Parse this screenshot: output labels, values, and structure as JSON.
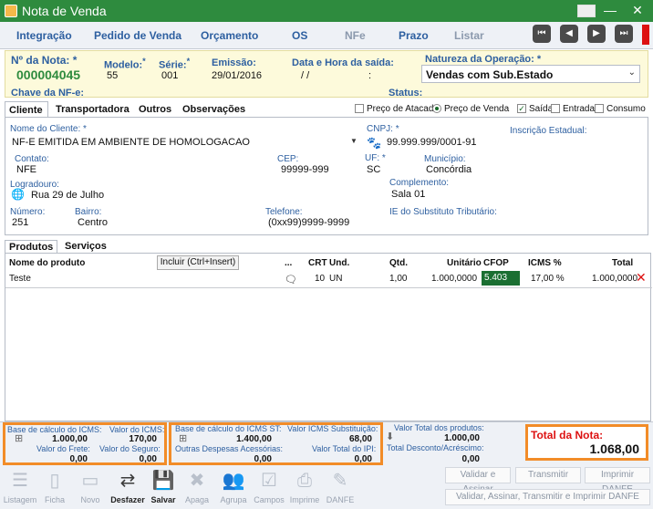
{
  "window": {
    "title": "Nota de Venda"
  },
  "menu": {
    "items": [
      {
        "label": "Integração",
        "enabled": true
      },
      {
        "label": "Pedido de Venda",
        "enabled": true
      },
      {
        "label": "Orçamento",
        "enabled": true
      },
      {
        "label": "OS",
        "enabled": true
      },
      {
        "label": "NFe",
        "enabled": false
      },
      {
        "label": "Prazo",
        "enabled": true
      },
      {
        "label": "Listar",
        "enabled": false
      }
    ]
  },
  "header": {
    "numero_label": "Nº da Nota:",
    "numero_value": "000004045",
    "modelo_label": "Modelo:",
    "modelo_value": "55",
    "serie_label": "Série:",
    "serie_value": "001",
    "emissao_label": "Emissão:",
    "emissao_value": "29/01/2016",
    "saida_label": "Data e Hora da saída:",
    "saida_value": "/ /",
    "saida_time": ":",
    "natureza_label": "Natureza da Operação:",
    "natureza_value": "Vendas com Sub.Estado",
    "chave_label": "Chave da NF-e:",
    "status_label": "Status:"
  },
  "tabs": [
    "Cliente",
    "Transportadora",
    "Outros",
    "Observações"
  ],
  "options": {
    "preco_atacado": "Preço de Atacado",
    "preco_venda": "Preço de Venda",
    "saida": "Saída",
    "entrada": "Entrada",
    "consumo": "Consumo"
  },
  "cliente": {
    "nome_label": "Nome do Cliente:",
    "nome_value": "NF-E EMITIDA EM AMBIENTE DE HOMOLOGACAO",
    "cnpj_label": "CNPJ:",
    "cnpj_value": "99.999.999/0001-91",
    "ie_label": "Inscrição Estadual:",
    "contato_label": "Contato:",
    "contato_value": "NFE",
    "cep_label": "CEP:",
    "cep_value": "99999-999",
    "uf_label": "UF:",
    "uf_value": "SC",
    "municipio_label": "Município:",
    "municipio_value": "Concórdia",
    "logradouro_label": "Logradouro:",
    "logradouro_value": "Rua 29 de Julho",
    "complemento_label": "Complemento:",
    "complemento_value": "Sala 01",
    "numero_label": "Número:",
    "numero_value": "251",
    "bairro_label": "Bairro:",
    "bairro_value": "Centro",
    "telefone_label": "Telefone:",
    "telefone_value": "(0xx99)9999-9999",
    "ie_st_label": "IE do Substituto Tributário:"
  },
  "product_tabs": [
    "Produtos",
    "Serviços"
  ],
  "products": {
    "incluir_label": "Incluir (Ctrl+Insert)",
    "headers": {
      "nome": "Nome do produto",
      "dots": "...",
      "crt": "CRT",
      "und": "Und.",
      "qtd": "Qtd.",
      "unitario": "Unitário",
      "cfop": "CFOP",
      "icms": "ICMS %",
      "total": "Total"
    },
    "rows": [
      {
        "nome": "Teste",
        "crt": "10",
        "und": "UN",
        "qtd": "1,00",
        "unitario": "1.000,0000",
        "cfop": "5.403",
        "icms": "17,00 %",
        "total": "1.000,0000"
      }
    ]
  },
  "totals": {
    "base_icms_label": "Base de cálculo do ICMS:",
    "base_icms_value": "1.000,00",
    "valor_icms_label": "Valor do ICMS:",
    "valor_icms_value": "170,00",
    "frete_label": "Valor do Frete:",
    "frete_value": "0,00",
    "seguro_label": "Valor do Seguro:",
    "seguro_value": "0,00",
    "base_st_label": "Base de cálculo do ICMS ST:",
    "base_st_value": "1.400,00",
    "icms_sub_label": "Valor ICMS Substituição:",
    "icms_sub_value": "68,00",
    "outras_label": "Outras Despesas Acessórias:",
    "outras_value": "0,00",
    "ipi_label": "Valor Total do IPI:",
    "ipi_value": "0,00",
    "prod_label": "Valor Total dos produtos:",
    "prod_value": "1.000,00",
    "desconto_label": "Total Desconto/Acréscimo:",
    "desconto_value": "0,00",
    "total_label": "Total da Nota:",
    "total_value": "1.068,00"
  },
  "toolbar": {
    "buttons": [
      "Listagem",
      "Ficha",
      "Novo",
      "Desfazer",
      "Salvar",
      "Apaga",
      "Agrupa",
      "Campos",
      "Imprime",
      "DANFE"
    ]
  },
  "actions": {
    "validar_assinar": "Validar e Assinar",
    "transmitir": "Transmitir",
    "imprimir_danfe": "Imprimir DANFE",
    "all": "Validar, Assinar, Transmitir e Imprimir DANFE"
  },
  "colors": {
    "accent": "#2e8b3e",
    "label_blue": "#2d5fa0",
    "highlight": "#f28c28",
    "cfop_bg": "#1b6f32"
  }
}
